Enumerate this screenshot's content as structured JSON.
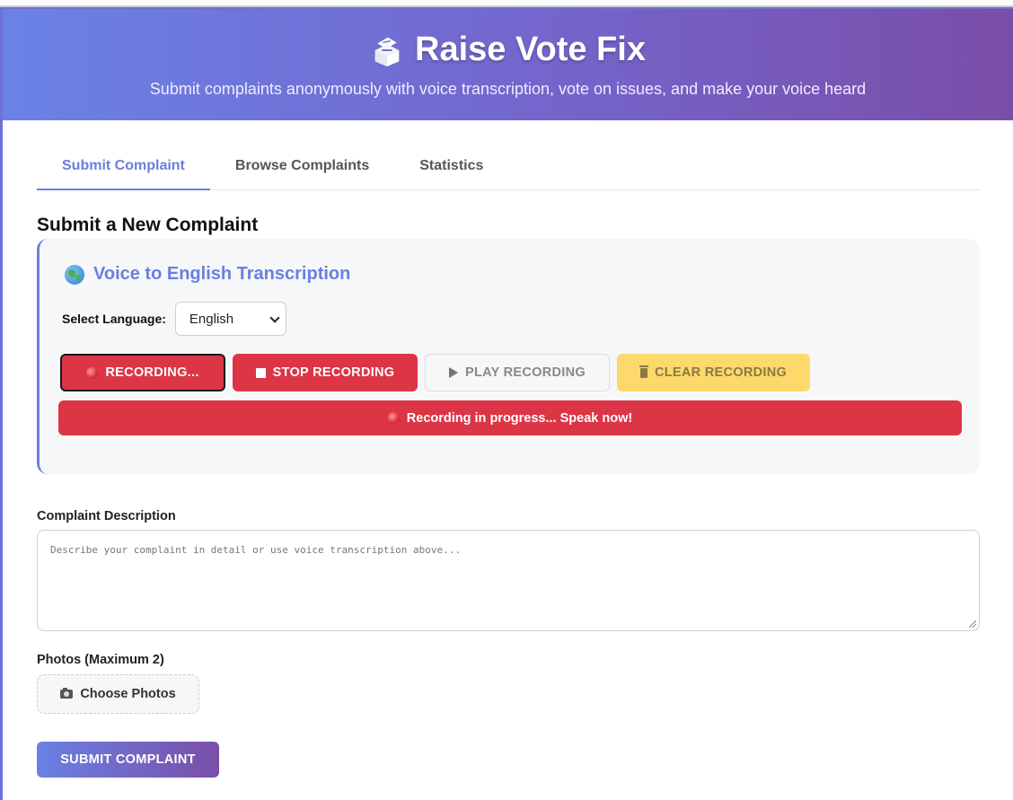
{
  "header": {
    "title": "Raise Vote Fix",
    "subtitle": "Submit complaints anonymously with voice transcription, vote on issues, and make your voice heard",
    "icon": "ballot-box-icon"
  },
  "tabs": [
    {
      "label": "Submit Complaint",
      "active": true
    },
    {
      "label": "Browse Complaints",
      "active": false
    },
    {
      "label": "Statistics",
      "active": false
    }
  ],
  "form": {
    "section_title": "Submit a New Complaint",
    "voice": {
      "title": "Voice to English Transcription",
      "language_label": "Select Language:",
      "language_value": "English",
      "buttons": {
        "recording": "RECORDING...",
        "stop": "STOP RECORDING",
        "play": "PLAY RECORDING",
        "clear": "CLEAR RECORDING"
      },
      "status": "Recording in progress... Speak now!"
    },
    "description_label": "Complaint Description",
    "description_placeholder": "Describe your complaint in detail or use voice transcription above...",
    "photos_label": "Photos (Maximum 2)",
    "photos_button": "Choose Photos",
    "submit_label": "SUBMIT COMPLAINT"
  },
  "colors": {
    "accent": "#6a7fe0",
    "danger": "#dc3545",
    "warning": "#fcd96a",
    "header_gradient_start": "#6a82e6",
    "header_gradient_end": "#7a4ea8"
  }
}
